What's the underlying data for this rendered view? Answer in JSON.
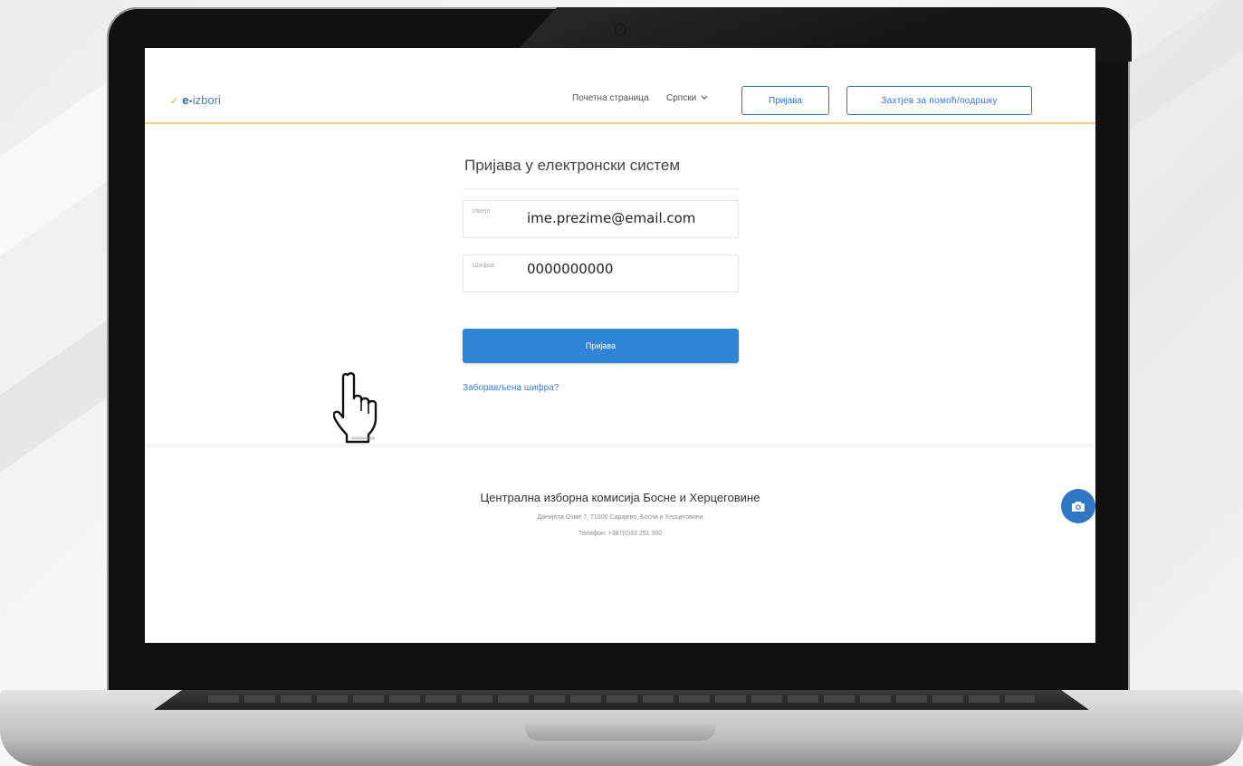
{
  "brand": {
    "prefix": "e-",
    "name": "izbori"
  },
  "nav": {
    "home": "Почетна страница",
    "language": "Српски",
    "login_button": "Пријава",
    "help_button": "Захтјев за помоћ/подршку"
  },
  "form": {
    "title": "Пријава у електронски систем",
    "email_label": "Имејл",
    "email_value": "ime.prezime@email.com",
    "password_label": "Шифра",
    "password_value": "0000000000",
    "submit_label": "Пријава",
    "forgot_link": "Заборављена шифра?"
  },
  "footer": {
    "title": "Централна изборна комисија Босне и Херцеговине",
    "address": "Данијела Озме 7, 71000 Сарајево, Босна и Херцеговина",
    "phone": "Телефон: +387(0)33 251 300"
  },
  "colors": {
    "primary": "#2f86d6",
    "accent": "#f2c98a"
  },
  "icons": [
    "check-logo-icon",
    "chevron-down-icon",
    "camera-icon",
    "hand-cursor-icon"
  ]
}
